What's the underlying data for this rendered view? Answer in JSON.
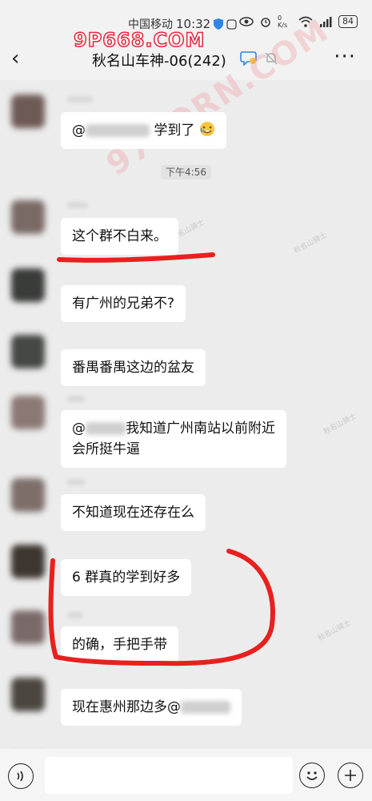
{
  "status_bar": {
    "carrier": "中国移动",
    "time": "10:32",
    "network_speed": "0 K/s",
    "battery": "84"
  },
  "watermark": {
    "top": "9P668.COM",
    "diagonal": "97PORN.COM",
    "small": "秋名山骑士"
  },
  "header": {
    "back_glyph": "‹",
    "title": "秋名山车神-06(242)",
    "more_glyph": "···"
  },
  "timestamp": "下午4:56",
  "messages": [
    {
      "pre": "@",
      "post": "学到了"
    },
    {
      "text": "这个群不白来。"
    },
    {
      "text": "有广州的兄弟不?"
    },
    {
      "text": "番禺番禺这边的盆友"
    },
    {
      "line1_pre": "@",
      "line1_post": "我知道广州南站以前附近",
      "line2": "会所挺牛逼"
    },
    {
      "text": "不知道现在还存在么"
    },
    {
      "text": "6 群真的学到好多"
    },
    {
      "text": "的确，手把手带"
    },
    {
      "pre": "现在惠州那边多@"
    }
  ],
  "input": {
    "placeholder": ""
  }
}
